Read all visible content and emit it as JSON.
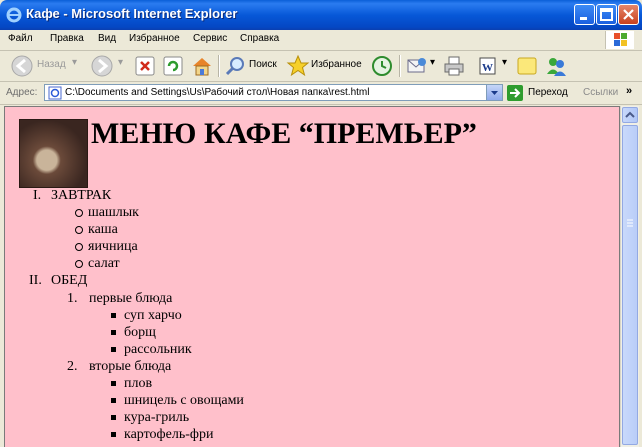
{
  "window": {
    "title": "Кафе - Microsoft Internet Explorer"
  },
  "menubar": {
    "items": [
      "Файл",
      "Правка",
      "Вид",
      "Избранное",
      "Сервис",
      "Справка"
    ]
  },
  "toolbar": {
    "back_label": "Назад",
    "search_label": "Поиск",
    "favorites_label": "Избранное"
  },
  "address": {
    "label": "Адрес:",
    "value": "C:\\Documents and Settings\\Us\\Рабочий стол\\Новая папка\\rest.html",
    "go_label": "Переход",
    "links_label": "Ссылки",
    "links_chevron": "»"
  },
  "page": {
    "heading": "МЕНЮ КАФЕ “ПРЕМЬЕР”",
    "sections": [
      {
        "marker": "I.",
        "title": "ЗАВТРАК",
        "items": [
          "шашлык",
          "каша",
          "яичница",
          "салат"
        ]
      },
      {
        "marker": "II.",
        "title": "ОБЕД",
        "groups": [
          {
            "marker": "1.",
            "title": "первые блюда",
            "items": [
              "суп харчо",
              "борщ",
              "рассольник"
            ]
          },
          {
            "marker": "2.",
            "title": "вторые блюда",
            "items": [
              "плов",
              "шницель с овощами",
              "кура-гриль",
              "картофель-фри"
            ]
          }
        ]
      }
    ]
  },
  "colors": {
    "page_background": "#ffc0cb",
    "titlebar": "#0758d8"
  }
}
